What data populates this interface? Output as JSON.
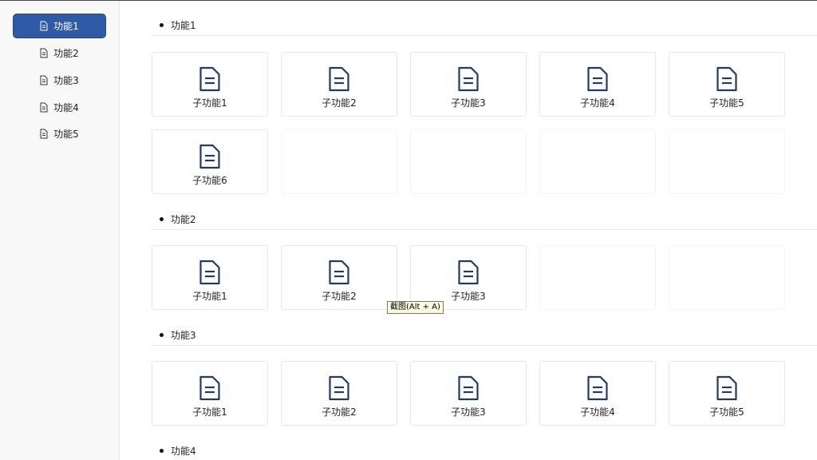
{
  "sidebar": {
    "items": [
      {
        "label": "功能1",
        "icon": "document-icon",
        "active": true
      },
      {
        "label": "功能2",
        "icon": "document-icon",
        "active": false
      },
      {
        "label": "功能3",
        "icon": "document-icon",
        "active": false
      },
      {
        "label": "功能4",
        "icon": "document-icon",
        "active": false
      },
      {
        "label": "功能5",
        "icon": "document-icon",
        "active": false
      }
    ]
  },
  "sections": [
    {
      "title": "功能1",
      "cards": [
        "子功能1",
        "子功能2",
        "子功能3",
        "子功能4",
        "子功能5",
        "子功能6"
      ]
    },
    {
      "title": "功能2",
      "cards": [
        "子功能1",
        "子功能2",
        "子功能3"
      ]
    },
    {
      "title": "功能3",
      "cards": [
        "子功能1",
        "子功能2",
        "子功能3",
        "子功能4",
        "子功能5"
      ]
    },
    {
      "title": "功能4",
      "cards": []
    }
  ],
  "tooltip": {
    "text": "截图(Alt + A)"
  },
  "colors": {
    "accent": "#2f5aa6",
    "icon": "#1f3a6b"
  }
}
